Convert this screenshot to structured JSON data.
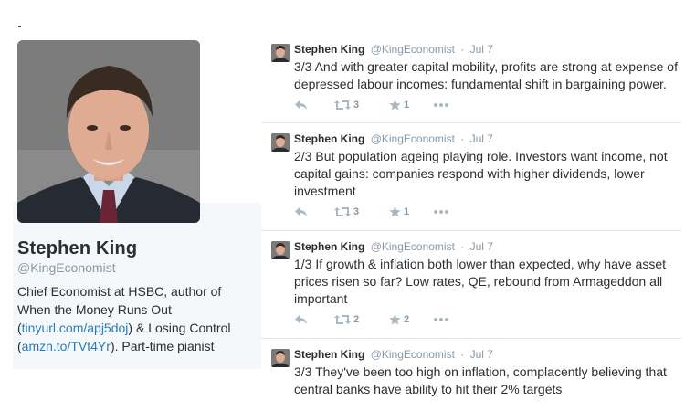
{
  "profile": {
    "name": "Stephen King",
    "handle": "@KingEconomist",
    "bio": {
      "line1": "Chief Economist at HSBC, author of",
      "line2": "When the Money Runs Out",
      "link1": "tinyurl.com/apj5doj",
      "middle": " & Losing Control",
      "link2": "amzn.to/TVt4Yr",
      "end": ". Part-time pianist"
    }
  },
  "tweets": [
    {
      "name": "Stephen King",
      "handle": "@KingEconomist",
      "separator": "·",
      "date": "Jul 7",
      "text": "3/3 And with greater capital mobility, profits are strong at expense of depressed labour incomes: fundamental shift in bargaining power.",
      "retweets": "3",
      "favorites": "1"
    },
    {
      "name": "Stephen King",
      "handle": "@KingEconomist",
      "separator": "·",
      "date": "Jul 7",
      "text": "2/3 But population ageing playing role. Investors want income, not capital gains: companies respond with higher dividends, lower investment",
      "retweets": "3",
      "favorites": "1"
    },
    {
      "name": "Stephen King",
      "handle": "@KingEconomist",
      "separator": "·",
      "date": "Jul 7",
      "text": "1/3 If growth & inflation both lower than expected, why have asset prices risen so far? Low rates, QE, rebound from Armageddon all important",
      "retweets": "2",
      "favorites": "2"
    },
    {
      "name": "Stephen King",
      "handle": "@KingEconomist",
      "separator": "·",
      "date": "Jul 7",
      "text": "3/3 They've been too high on inflation, complacently believing that central banks have ability to hit their 2% targets"
    }
  ],
  "icons": {
    "reply": "reply-icon",
    "retweet": "retweet-icon",
    "favorite": "star-icon",
    "more": "more-icon"
  },
  "colors": {
    "link": "#2b7bb9",
    "muted": "#8899a6",
    "action": "#aab8c2",
    "text": "#292f33",
    "card_bg": "#f5f8fa",
    "divider": "#e1e8ed"
  }
}
